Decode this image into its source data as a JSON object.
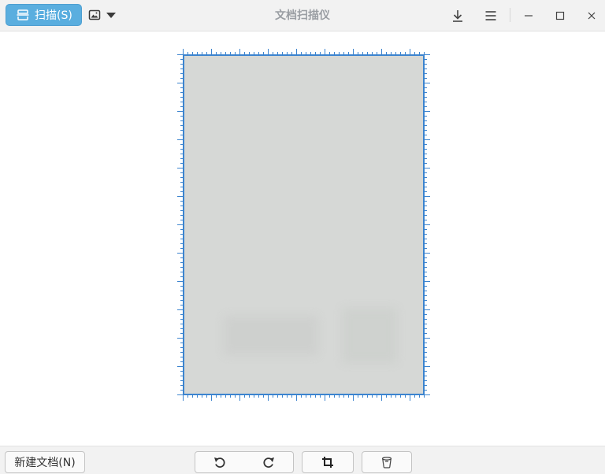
{
  "window": {
    "title": "文档扫描仪"
  },
  "header": {
    "scan_button_label": "扫描(S)",
    "icons": {
      "scan": "scanner-icon",
      "image_menu": "image-icon",
      "download": "download-icon",
      "menu": "hamburger-menu-icon",
      "minimize": "minimize-icon",
      "maximize": "maximize-icon",
      "close": "close-icon"
    }
  },
  "bottom": {
    "new_document_label": "新建文档(N)",
    "icons": {
      "rotate_left": "rotate-left-icon",
      "rotate_right": "rotate-right-icon",
      "crop": "crop-icon",
      "delete": "trash-icon"
    }
  },
  "colors": {
    "accent": "#5aaedf",
    "selection_border": "#3c84cf",
    "page": "#d6d8d6",
    "title": "#9a9ea3"
  }
}
